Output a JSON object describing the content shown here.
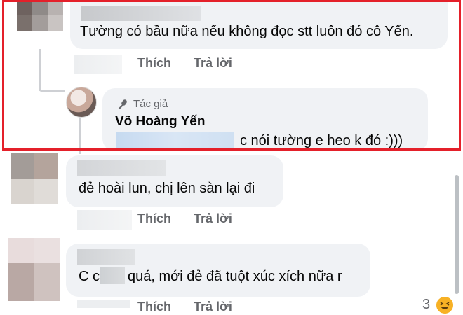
{
  "colors": {
    "highlight": "#e4202a",
    "bubble": "#f0f2f5",
    "action_text": "#65676b",
    "author_badge": "#65676b",
    "reaction": "#f7b125"
  },
  "comments": [
    {
      "text": "Tường có bầu nữa nếu không đọc stt luôn đó cô Yến.",
      "like_label": "Thích",
      "reply_label": "Trả lời"
    },
    {
      "author_badge_icon": "microphone-icon",
      "author_badge": "Tác giả",
      "author_name": "Võ Hoàng Yến",
      "text_visible": "c nói tường e heo k đó :)))"
    },
    {
      "text": "đẻ hoài lun, chị lên sàn lại đi",
      "like_label": "Thích",
      "reply_label": "Trả lời"
    },
    {
      "text_prefix": "C c",
      "text_suffix": "quá, mới đẻ đã tuột xúc xích nữa r",
      "like_label": "Thích",
      "reply_label": "Trả lời",
      "reaction_count": "3",
      "reaction_icon": "haha-emoji-icon"
    }
  ]
}
